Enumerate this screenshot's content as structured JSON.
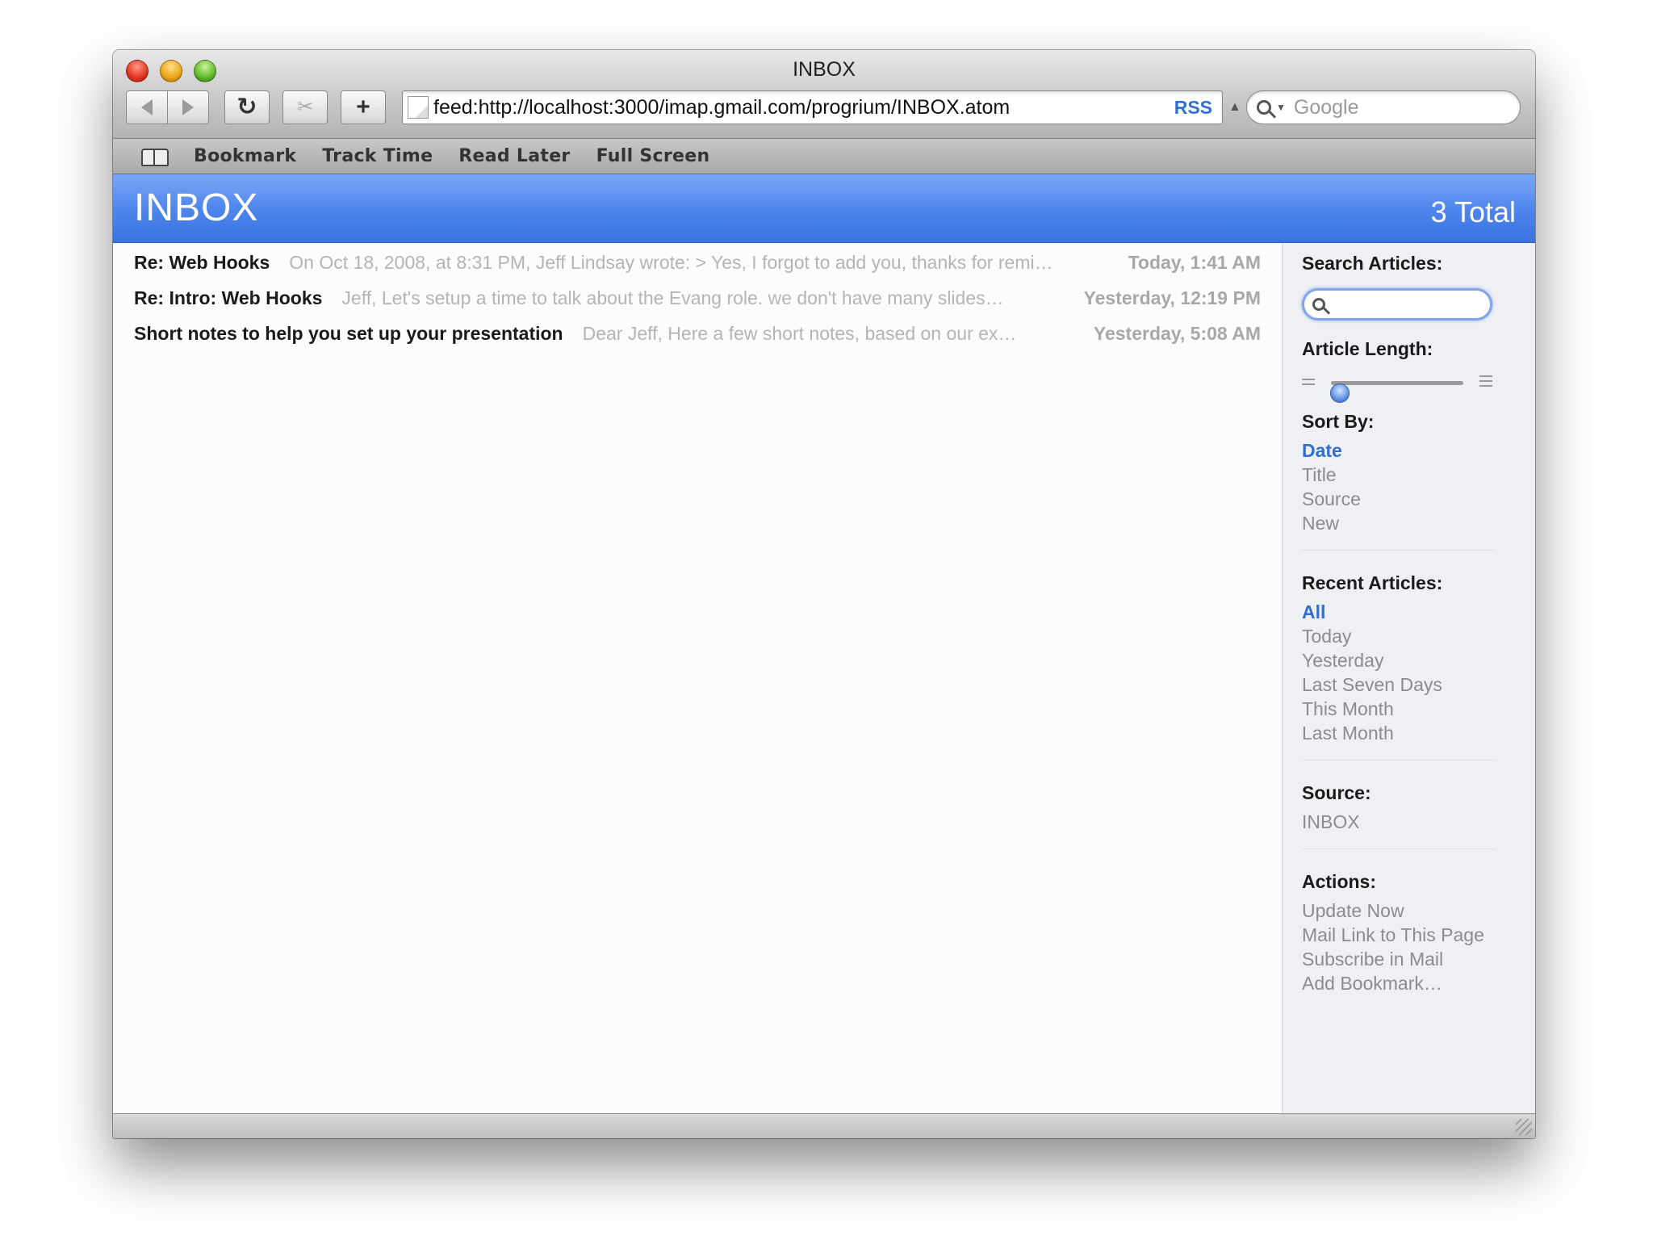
{
  "window": {
    "title": "INBOX"
  },
  "toolbar": {
    "url": "feed:http://localhost:3000/imap.gmail.com/progrium/INBOX.atom",
    "rss_label": "RSS",
    "search_placeholder": "Google",
    "icons": [
      "back-icon",
      "forward-icon",
      "reload-icon",
      "snip-icon",
      "add-icon"
    ]
  },
  "bookmarks": [
    "Bookmark",
    "Track Time",
    "Read Later",
    "Full Screen"
  ],
  "header": {
    "title": "INBOX",
    "total": "3 Total",
    "accent": "#4d84ec"
  },
  "articles": [
    {
      "title": "Re: Web Hooks",
      "snippet": "On Oct 18, 2008, at 8:31 PM, Jeff Lindsay wrote: > Yes, I forgot to add you, thanks for remi…",
      "date": "Today, 1:41 AM"
    },
    {
      "title": "Re: Intro: Web Hooks",
      "snippet": "Jeff, Let's setup a time to talk about the Evang role. we don't have many slides…",
      "date": "Yesterday, 12:19 PM"
    },
    {
      "title": "Short notes to help you set up your presentation",
      "snippet": "Dear Jeff, Here a few short notes, based on our ex…",
      "date": "Yesterday, 5:08 AM"
    }
  ],
  "sidebar": {
    "search_heading": "Search Articles:",
    "search_value": "",
    "length_heading": "Article Length:",
    "length_level": 0.07,
    "sort_heading": "Sort By:",
    "sort_options": [
      "Date",
      "Title",
      "Source",
      "New"
    ],
    "sort_active": "Date",
    "recent_heading": "Recent Articles:",
    "recent_options": [
      "All",
      "Today",
      "Yesterday",
      "Last Seven Days",
      "This Month",
      "Last Month"
    ],
    "recent_active": "All",
    "source_heading": "Source:",
    "source_value": "INBOX",
    "actions_heading": "Actions:",
    "actions": [
      "Update Now",
      "Mail Link to This Page",
      "Subscribe in Mail",
      "Add Bookmark…"
    ],
    "active_color": "#2e6ed4"
  }
}
